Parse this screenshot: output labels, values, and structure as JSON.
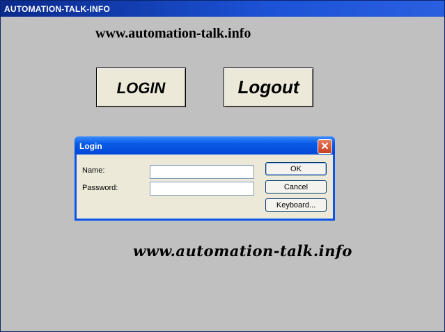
{
  "window": {
    "title": "AUTOMATION-TALK-INFO"
  },
  "header": {
    "url_text": "www.automation-talk.info"
  },
  "buttons": {
    "login_label": "LOGIN",
    "logout_label": "Logout"
  },
  "login_dialog": {
    "title": "Login",
    "close_glyph": "✕",
    "name_label": "Name:",
    "name_value": "",
    "password_label": "Password:",
    "password_value": "",
    "ok_label": "OK",
    "cancel_label": "Cancel",
    "keyboard_label": "Keyboard..."
  },
  "footer": {
    "url_text": "www.automation-talk.info"
  },
  "icons": {
    "close": "close-icon"
  },
  "colors": {
    "titlebar": "#0a2a8c",
    "dialog_titlebar": "#0a5ae6",
    "background": "#c0c0c0",
    "button_face": "#ece9d8"
  }
}
